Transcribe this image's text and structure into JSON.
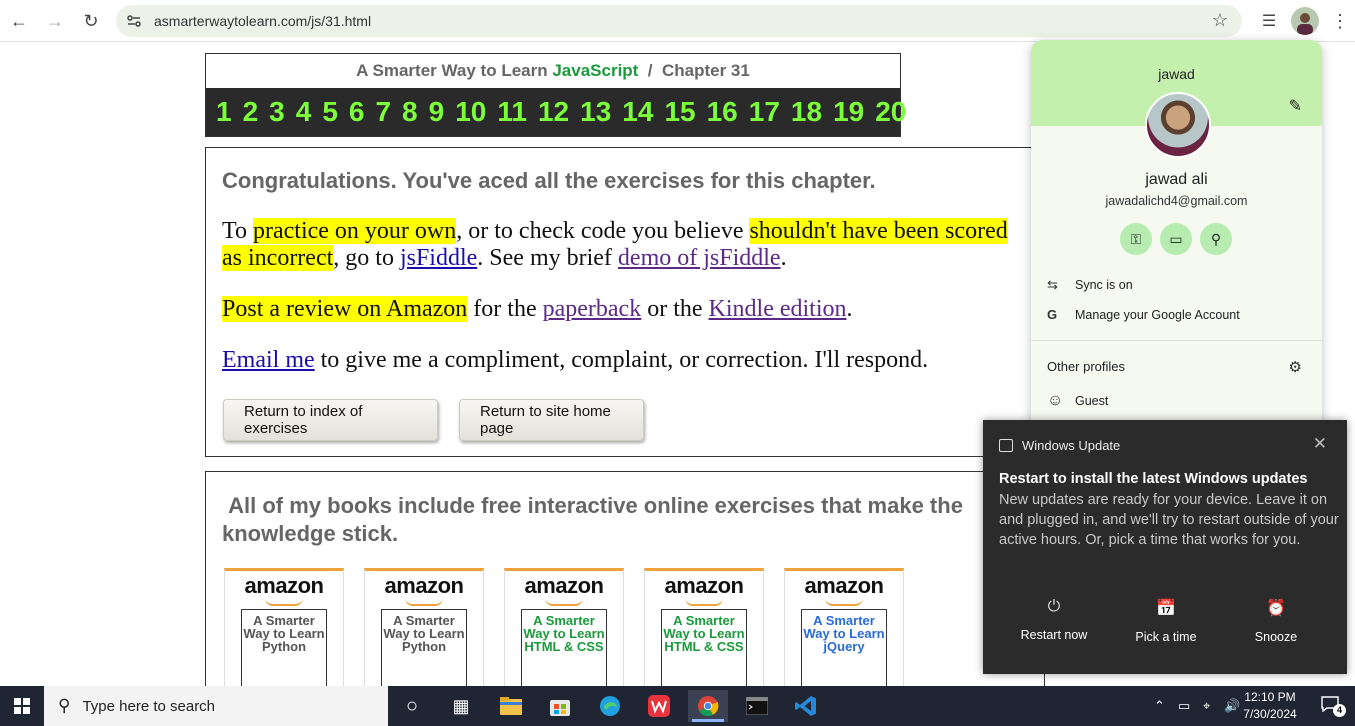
{
  "browser": {
    "url": "asmarterwaytolearn.com/js/31.html"
  },
  "page": {
    "header": {
      "title_prefix": "A Smarter Way to Learn ",
      "title_js": "JavaScript",
      "title_suffix": "  /  Chapter 31",
      "chapters": [
        "1",
        "2",
        "3",
        "4",
        "5",
        "6",
        "7",
        "8",
        "9",
        "10",
        "11",
        "12",
        "13",
        "14",
        "15",
        "16",
        "17",
        "18",
        "19",
        "20"
      ]
    },
    "content": {
      "congrats": "Congratulations. You've aced all the exercises for this chapter.",
      "p1_a": "To ",
      "p1_hl1": "practice on your own",
      "p1_b": ", or to check code you believe ",
      "p1_hl2": "shouldn't have been scored as incorrect",
      "p1_c": ", go to ",
      "p1_link1": "jsFiddle",
      "p1_d": ". See my brief ",
      "p1_link2": "demo of jsFiddle",
      "p1_e": ".",
      "p2_hl": "Post a review on Amazon",
      "p2_a": " for the ",
      "p2_link1": "paperback",
      "p2_b": " or the ",
      "p2_link2": "Kindle edition",
      "p2_c": ".",
      "p3_link": "Email me",
      "p3_a": " to give me a compliment, complaint, or correction. I'll respond.",
      "btn_index": "Return to index of exercises",
      "btn_home": "Return to site home page"
    },
    "books": {
      "heading": " All of my books include free interactive online exercises that make the knowledge stick.",
      "items": [
        {
          "brand": "amazon",
          "title": "A Smarter Way to Learn Python",
          "color": "#555555"
        },
        {
          "brand": "amazon",
          "title": "A Smarter Way to Learn Python",
          "color": "#555555"
        },
        {
          "brand": "amazon",
          "title": "A Smarter Way to Learn HTML & CSS",
          "color": "#1c9a3c"
        },
        {
          "brand": "amazon",
          "title": "A Smarter Way to Learn HTML & CSS",
          "color": "#1c9a3c"
        },
        {
          "brand": "amazon",
          "title": "A Smarter Way to Learn jQuery",
          "color": "#2a6bd4"
        }
      ]
    }
  },
  "profile": {
    "name_top": "jawad",
    "full_name": "jawad ali",
    "email": "jawadalichd4@gmail.com",
    "sync": "Sync is on",
    "manage": "Manage your Google Account",
    "other_profiles": "Other profiles",
    "guest": "Guest"
  },
  "toast": {
    "app": "Windows Update",
    "title": "Restart to install the latest Windows updates",
    "message": "New updates are ready for your device. Leave it on and plugged in, and we'll try to restart outside of your active hours. Or, pick a time that works for you.",
    "actions": [
      "Restart now",
      "Pick a time",
      "Snooze"
    ]
  },
  "taskbar": {
    "search_placeholder": "Type here to search",
    "time": "12:10 PM",
    "date": "7/30/2024",
    "notification_count": "4"
  }
}
